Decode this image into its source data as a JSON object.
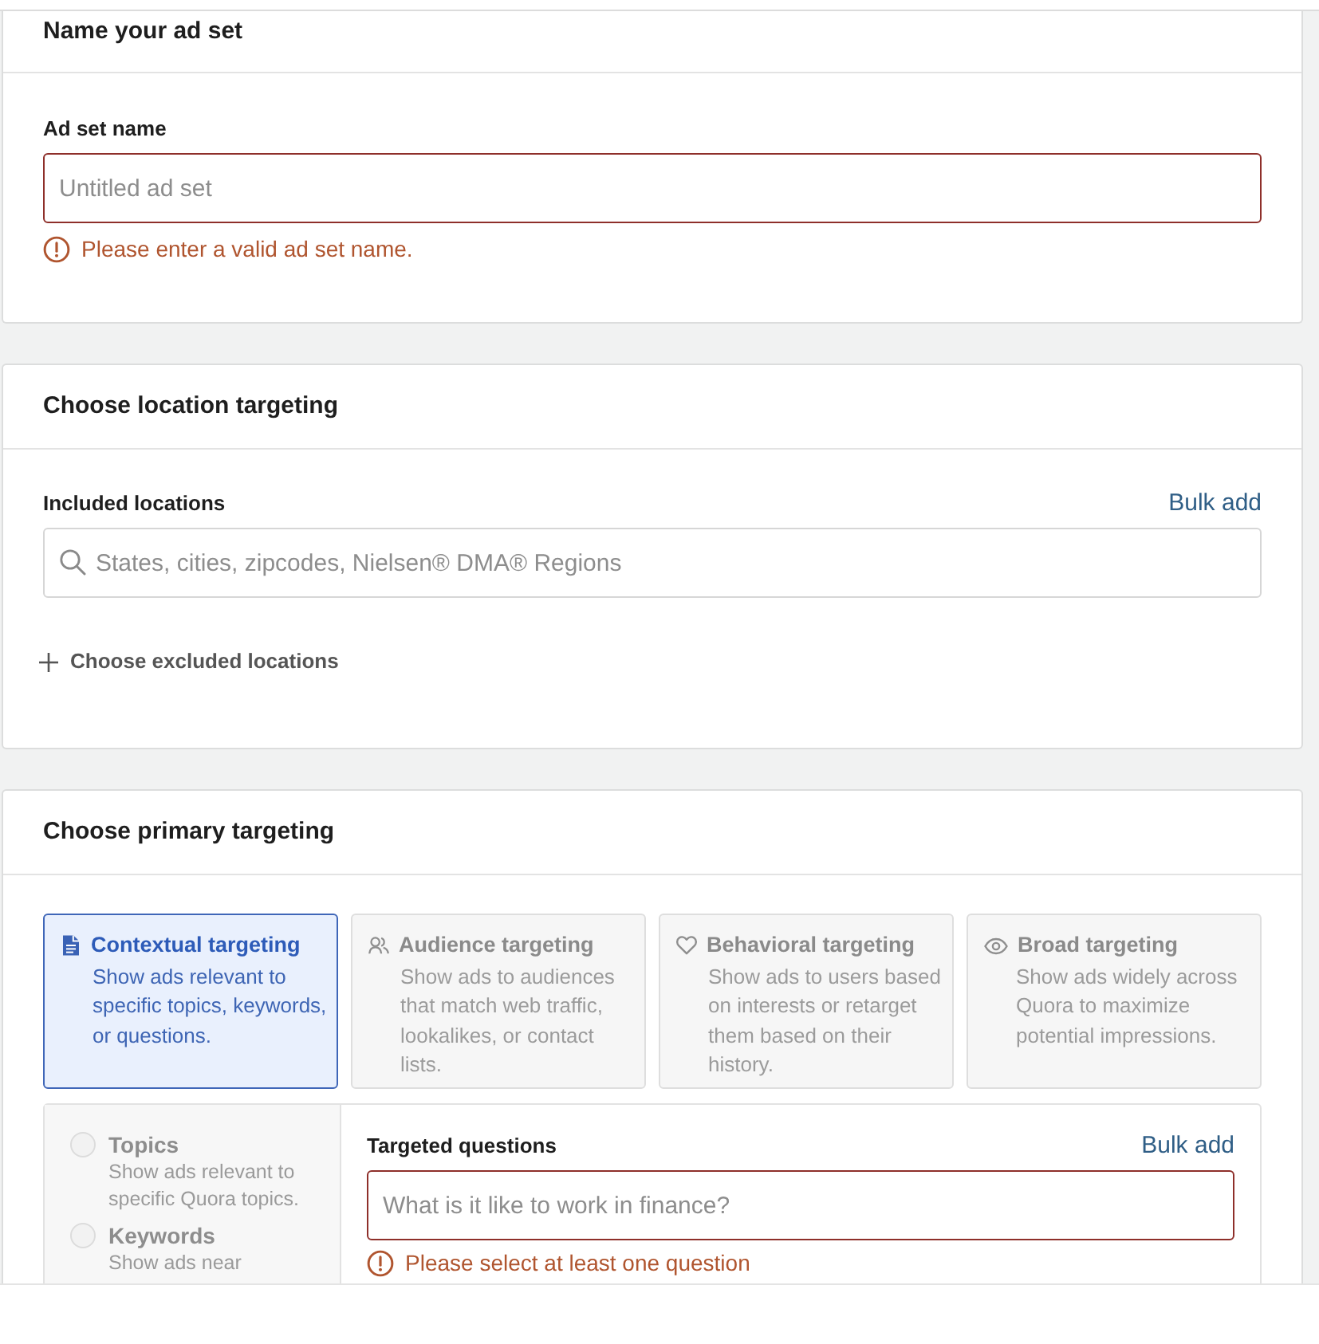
{
  "name_card": {
    "title": "Name your ad set",
    "field": {
      "label": "Ad set name",
      "placeholder": "Untitled ad set",
      "error": "Please enter a valid ad set name."
    }
  },
  "location_card": {
    "title": "Choose location targeting",
    "field": {
      "label": "Included locations",
      "link": "Bulk add",
      "placeholder": "States, cities, zipcodes, Nielsen® DMA® Regions"
    },
    "add_link": "Choose excluded locations"
  },
  "primary_targeting_card": {
    "title": "Choose primary targeting",
    "options": [
      {
        "kind": "contextual",
        "title": "Contextual targeting",
        "description": "Show ads relevant to specific topics, keywords, or questions.",
        "selected": true
      },
      {
        "kind": "audience",
        "title": "Audience targeting",
        "description": "Show ads to audiences that match web traffic, lookalikes, or contact lists.",
        "selected": false
      },
      {
        "kind": "behavioral",
        "title": "Behavioral targeting",
        "description": "Show ads to users based on interests or retarget them based on their history.",
        "selected": false
      },
      {
        "kind": "broad",
        "title": "Broad targeting",
        "description": "Show ads widely across Quora to maximize potential impressions.",
        "selected": false
      }
    ],
    "sub_options": [
      {
        "title": "Topics",
        "description": "Show ads relevant to specific Quora topics.",
        "selected": false
      },
      {
        "title": "Keywords",
        "description": "Show ads near",
        "selected": false
      }
    ],
    "questions_field": {
      "label": "Targeted questions",
      "link": "Bulk add",
      "placeholder": "What is it like to work in finance?",
      "error": "Please select at least one question"
    }
  }
}
